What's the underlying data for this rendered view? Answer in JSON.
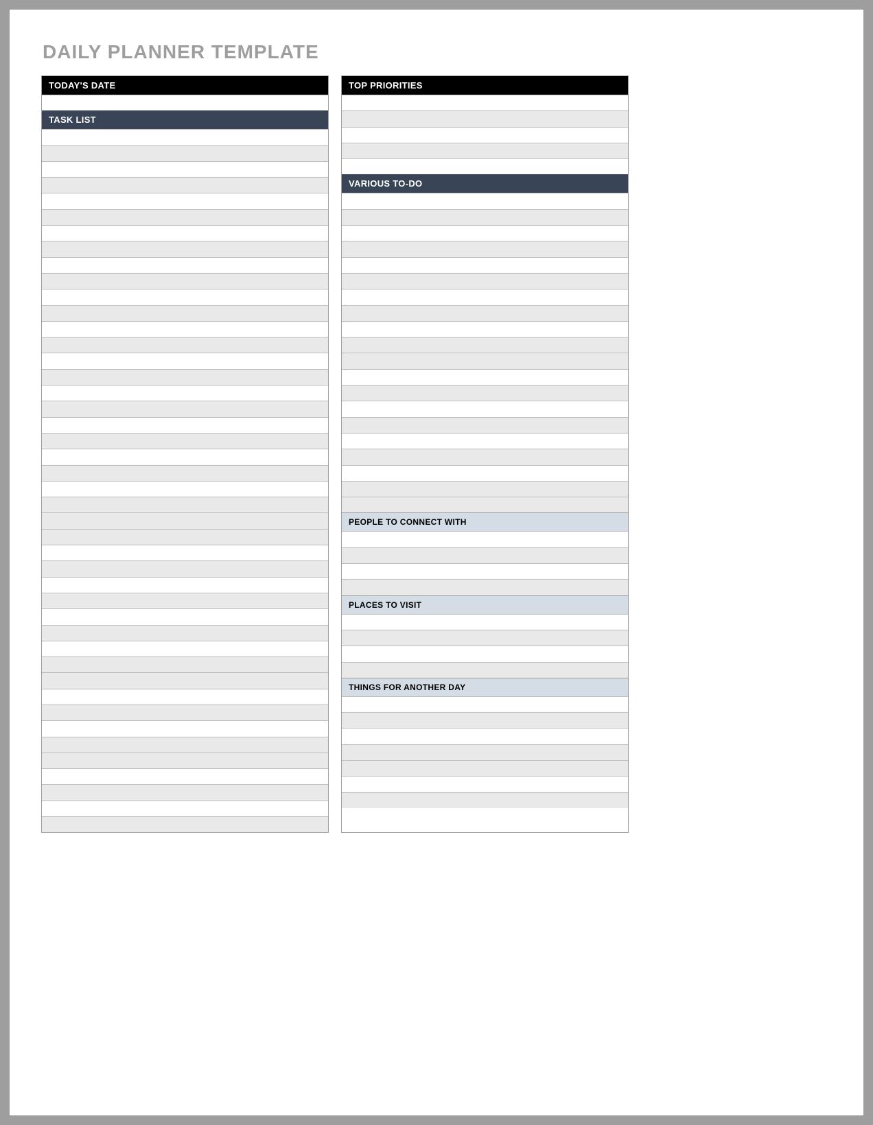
{
  "title": "DAILY PLANNER TEMPLATE",
  "left": {
    "todays_date": "TODAY'S DATE",
    "task_list": "TASK LIST"
  },
  "right": {
    "top_priorities": "TOP PRIORITIES",
    "various_todo": "VARIOUS TO-DO",
    "people": "PEOPLE TO CONNECT WITH",
    "places": "PLACES TO VISIT",
    "things": "THINGS FOR ANOTHER DAY"
  }
}
